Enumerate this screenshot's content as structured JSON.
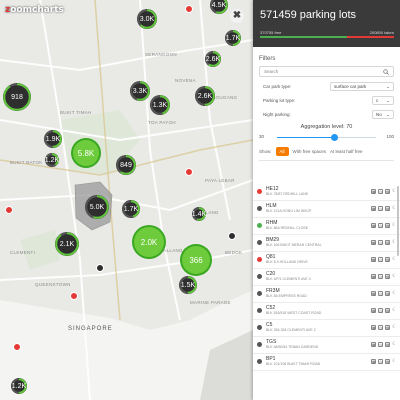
{
  "brand": {
    "prefix": "z",
    "rest": "oomcharts"
  },
  "map": {
    "close_glyph": "✖",
    "district_labels": [
      "NOVENA",
      "GEYLANG",
      "KALLANG",
      "SINGAPORE",
      "SERANGOON",
      "HOUGANG",
      "TOA PAYOH",
      "CLEMENTI",
      "BUKIT TIMAH",
      "BUKIT BATOK",
      "QUEENSTOWN",
      "PAYA LEBAR",
      "BEDOK",
      "MARINE PARADE"
    ],
    "clusters": [
      {
        "label": "3.0K",
        "fraction": 0.62
      },
      {
        "label": "4.5K",
        "fraction": 0.55
      },
      {
        "label": "1.7K",
        "fraction": 0.5
      },
      {
        "label": "2.6K",
        "fraction": 0.6
      },
      {
        "label": "918",
        "fraction": 0.9
      },
      {
        "label": "3.3K",
        "fraction": 0.55
      },
      {
        "label": "1.3K",
        "fraction": 0.45
      },
      {
        "label": "2.6K",
        "fraction": 0.5
      },
      {
        "label": "1.9K",
        "fraction": 0.5
      },
      {
        "label": "5.8K",
        "fraction": 0.92
      },
      {
        "label": "1.2K",
        "fraction": 0.4
      },
      {
        "label": "849",
        "fraction": 0.6
      },
      {
        "label": "5.0K",
        "fraction": 0.55
      },
      {
        "label": "1.7K",
        "fraction": 0.45
      },
      {
        "label": "1.4K",
        "fraction": 0.55
      },
      {
        "label": "2.1K",
        "fraction": 0.9
      },
      {
        "label": "2.0K",
        "fraction": 0.88
      },
      {
        "label": "366",
        "fraction": 0.55
      },
      {
        "label": "1.5K",
        "fraction": 0.5
      },
      {
        "label": "1.2K",
        "fraction": 0.5
      }
    ]
  },
  "panel": {
    "title": "571459 parking lots",
    "free_label": "370755 free",
    "taken_label": "200800 taken",
    "free_fraction": 0.65,
    "filters_title": "Filters",
    "search_placeholder": "Search",
    "car_park_type_label": "Car park type:",
    "car_park_type_value": "surface car park",
    "parking_lot_type_label": "Parking lot type:",
    "parking_lot_type_value": "c",
    "night_parking_label": "Night parking:",
    "night_parking_value": "No",
    "aggregation_label": "Aggregation level: 70",
    "slider_min": "30",
    "slider_max": "100",
    "slider_value": 70,
    "show_label": "Show:",
    "show_all": "All",
    "show_free": "With free spaces",
    "show_half": "At least half free",
    "items": [
      {
        "code": "HE12",
        "addr": "BLK 78/87 REDHILL LANE",
        "status": "#e53935"
      },
      {
        "code": "HLM",
        "addr": "BLK 121A HONG LIM WSCP",
        "status": "#555555"
      },
      {
        "code": "RHM",
        "addr": "BLK 86A REDHILL CLOSE",
        "status": "#4caf50"
      },
      {
        "code": "BM29",
        "addr": "BLK 165 BUKIT MERAH CENTRAL",
        "status": "#555555"
      },
      {
        "code": "Q81",
        "addr": "BLK 8-9 HOLLAND DRIVE",
        "status": "#e53935"
      },
      {
        "code": "C20",
        "addr": "BLK 4/F/1 CLEMENTI AVE 3",
        "status": "#555555"
      },
      {
        "code": "FR3M",
        "addr": "BLK 8A EMPRESS ROAD",
        "status": "#555555"
      },
      {
        "code": "C52",
        "addr": "BLK 516/518 WEST COAST ROAD",
        "status": "#555555"
      },
      {
        "code": "C5",
        "addr": "BLK 326-334 CLEMENTI AVE 2",
        "status": "#555555"
      },
      {
        "code": "TGS",
        "addr": "BLK 48/50/54 TEBAN GARDENS",
        "status": "#555555"
      },
      {
        "code": "BP1",
        "addr": "BLK 101/108 BUKIT TIMAH ROAD",
        "status": "#555555"
      }
    ]
  },
  "colors": {
    "free": "#4caf50",
    "taken": "#e53935",
    "accent": "#2196f3",
    "cluster": "#2e2e2e",
    "highlight": "#6ecb3c"
  }
}
